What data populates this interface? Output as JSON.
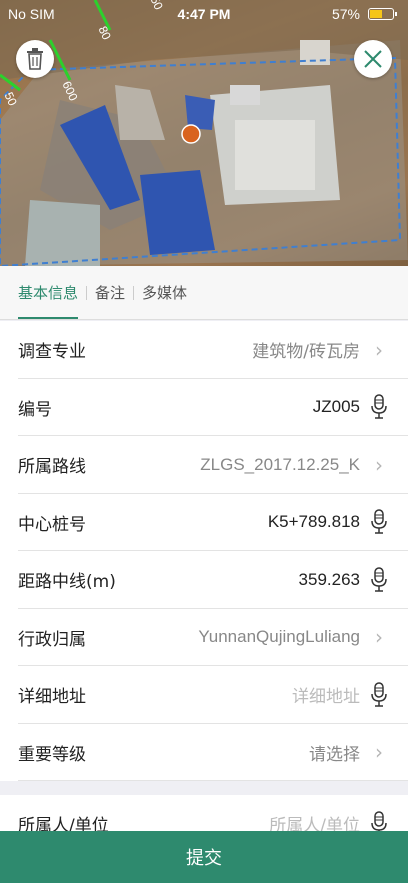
{
  "status_bar": {
    "carrier": "No SIM",
    "time": "4:47 PM",
    "battery": "57%",
    "battery_level": 0.57
  },
  "map": {
    "road_labels": [
      "50",
      "600",
      "80",
      "50"
    ]
  },
  "tabs": [
    {
      "label": "基本信息",
      "active": true
    },
    {
      "label": "备注",
      "active": false
    },
    {
      "label": "多媒体",
      "active": false
    }
  ],
  "form": {
    "rows": [
      {
        "label": "调查专业",
        "value": "建筑物/砖瓦房",
        "accessory": "chevron"
      },
      {
        "label": "编号",
        "value": "JZ005",
        "accessory": "mic"
      },
      {
        "label": "所属路线",
        "value": "ZLGS_2017.12.25_K",
        "accessory": "chevron"
      },
      {
        "label": "中心桩号",
        "value": "K5+789.818",
        "accessory": "mic"
      },
      {
        "label": "距路中线(m)",
        "value": "359.263",
        "accessory": "mic"
      },
      {
        "label": "行政归属",
        "value": "YunnanQujingLuliang",
        "accessory": "chevron"
      },
      {
        "label": "详细地址",
        "placeholder": "详细地址",
        "accessory": "mic"
      },
      {
        "label": "重要等级",
        "value": "请选择",
        "accessory": "chevron"
      }
    ],
    "owner_row": {
      "label": "所属人/单位",
      "placeholder": "所属人/单位"
    }
  },
  "submit_label": "提交",
  "colors": {
    "accent": "#2e8a6e"
  }
}
